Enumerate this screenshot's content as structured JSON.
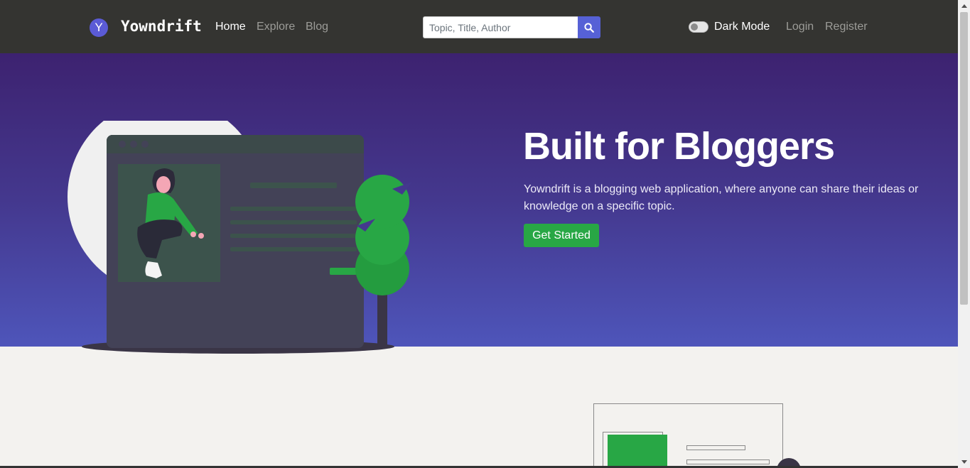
{
  "brand": {
    "logo_letter": "Y",
    "name": "Yowndrift"
  },
  "nav": {
    "home": "Home",
    "explore": "Explore",
    "blog": "Blog"
  },
  "search": {
    "placeholder": "Topic, Title, Author",
    "icon": "search-icon"
  },
  "dark_mode": {
    "label": "Dark Mode",
    "enabled": false
  },
  "auth": {
    "login": "Login",
    "register": "Register"
  },
  "hero": {
    "title": "Built for Bloggers",
    "description": "Yowndrift is a blogging web application, where anyone can share their ideas or knowledge on a specific topic.",
    "cta": "Get Started"
  },
  "colors": {
    "navbar": "#343431",
    "hero_top": "#3d2270",
    "hero_bottom": "#4e55ba",
    "accent_green": "#28a745",
    "search_button": "#5661d6"
  }
}
